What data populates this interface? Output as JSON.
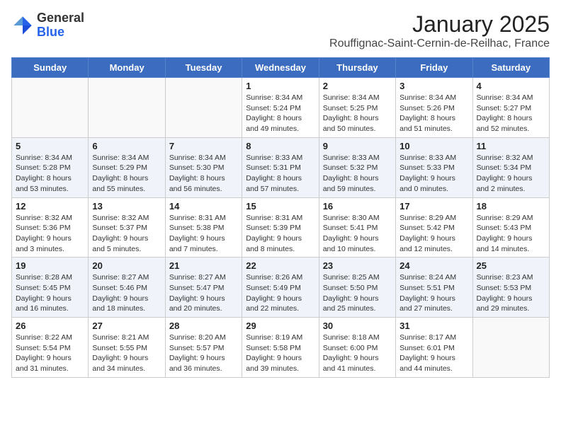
{
  "header": {
    "logo_general": "General",
    "logo_blue": "Blue",
    "month_title": "January 2025",
    "location": "Rouffignac-Saint-Cernin-de-Reilhac, France"
  },
  "weekdays": [
    "Sunday",
    "Monday",
    "Tuesday",
    "Wednesday",
    "Thursday",
    "Friday",
    "Saturday"
  ],
  "weeks": [
    [
      {
        "day": "",
        "info": ""
      },
      {
        "day": "",
        "info": ""
      },
      {
        "day": "",
        "info": ""
      },
      {
        "day": "1",
        "info": "Sunrise: 8:34 AM\nSunset: 5:24 PM\nDaylight: 8 hours\nand 49 minutes."
      },
      {
        "day": "2",
        "info": "Sunrise: 8:34 AM\nSunset: 5:25 PM\nDaylight: 8 hours\nand 50 minutes."
      },
      {
        "day": "3",
        "info": "Sunrise: 8:34 AM\nSunset: 5:26 PM\nDaylight: 8 hours\nand 51 minutes."
      },
      {
        "day": "4",
        "info": "Sunrise: 8:34 AM\nSunset: 5:27 PM\nDaylight: 8 hours\nand 52 minutes."
      }
    ],
    [
      {
        "day": "5",
        "info": "Sunrise: 8:34 AM\nSunset: 5:28 PM\nDaylight: 8 hours\nand 53 minutes."
      },
      {
        "day": "6",
        "info": "Sunrise: 8:34 AM\nSunset: 5:29 PM\nDaylight: 8 hours\nand 55 minutes."
      },
      {
        "day": "7",
        "info": "Sunrise: 8:34 AM\nSunset: 5:30 PM\nDaylight: 8 hours\nand 56 minutes."
      },
      {
        "day": "8",
        "info": "Sunrise: 8:33 AM\nSunset: 5:31 PM\nDaylight: 8 hours\nand 57 minutes."
      },
      {
        "day": "9",
        "info": "Sunrise: 8:33 AM\nSunset: 5:32 PM\nDaylight: 8 hours\nand 59 minutes."
      },
      {
        "day": "10",
        "info": "Sunrise: 8:33 AM\nSunset: 5:33 PM\nDaylight: 9 hours\nand 0 minutes."
      },
      {
        "day": "11",
        "info": "Sunrise: 8:32 AM\nSunset: 5:34 PM\nDaylight: 9 hours\nand 2 minutes."
      }
    ],
    [
      {
        "day": "12",
        "info": "Sunrise: 8:32 AM\nSunset: 5:36 PM\nDaylight: 9 hours\nand 3 minutes."
      },
      {
        "day": "13",
        "info": "Sunrise: 8:32 AM\nSunset: 5:37 PM\nDaylight: 9 hours\nand 5 minutes."
      },
      {
        "day": "14",
        "info": "Sunrise: 8:31 AM\nSunset: 5:38 PM\nDaylight: 9 hours\nand 7 minutes."
      },
      {
        "day": "15",
        "info": "Sunrise: 8:31 AM\nSunset: 5:39 PM\nDaylight: 9 hours\nand 8 minutes."
      },
      {
        "day": "16",
        "info": "Sunrise: 8:30 AM\nSunset: 5:41 PM\nDaylight: 9 hours\nand 10 minutes."
      },
      {
        "day": "17",
        "info": "Sunrise: 8:29 AM\nSunset: 5:42 PM\nDaylight: 9 hours\nand 12 minutes."
      },
      {
        "day": "18",
        "info": "Sunrise: 8:29 AM\nSunset: 5:43 PM\nDaylight: 9 hours\nand 14 minutes."
      }
    ],
    [
      {
        "day": "19",
        "info": "Sunrise: 8:28 AM\nSunset: 5:45 PM\nDaylight: 9 hours\nand 16 minutes."
      },
      {
        "day": "20",
        "info": "Sunrise: 8:27 AM\nSunset: 5:46 PM\nDaylight: 9 hours\nand 18 minutes."
      },
      {
        "day": "21",
        "info": "Sunrise: 8:27 AM\nSunset: 5:47 PM\nDaylight: 9 hours\nand 20 minutes."
      },
      {
        "day": "22",
        "info": "Sunrise: 8:26 AM\nSunset: 5:49 PM\nDaylight: 9 hours\nand 22 minutes."
      },
      {
        "day": "23",
        "info": "Sunrise: 8:25 AM\nSunset: 5:50 PM\nDaylight: 9 hours\nand 25 minutes."
      },
      {
        "day": "24",
        "info": "Sunrise: 8:24 AM\nSunset: 5:51 PM\nDaylight: 9 hours\nand 27 minutes."
      },
      {
        "day": "25",
        "info": "Sunrise: 8:23 AM\nSunset: 5:53 PM\nDaylight: 9 hours\nand 29 minutes."
      }
    ],
    [
      {
        "day": "26",
        "info": "Sunrise: 8:22 AM\nSunset: 5:54 PM\nDaylight: 9 hours\nand 31 minutes."
      },
      {
        "day": "27",
        "info": "Sunrise: 8:21 AM\nSunset: 5:55 PM\nDaylight: 9 hours\nand 34 minutes."
      },
      {
        "day": "28",
        "info": "Sunrise: 8:20 AM\nSunset: 5:57 PM\nDaylight: 9 hours\nand 36 minutes."
      },
      {
        "day": "29",
        "info": "Sunrise: 8:19 AM\nSunset: 5:58 PM\nDaylight: 9 hours\nand 39 minutes."
      },
      {
        "day": "30",
        "info": "Sunrise: 8:18 AM\nSunset: 6:00 PM\nDaylight: 9 hours\nand 41 minutes."
      },
      {
        "day": "31",
        "info": "Sunrise: 8:17 AM\nSunset: 6:01 PM\nDaylight: 9 hours\nand 44 minutes."
      },
      {
        "day": "",
        "info": ""
      }
    ]
  ]
}
